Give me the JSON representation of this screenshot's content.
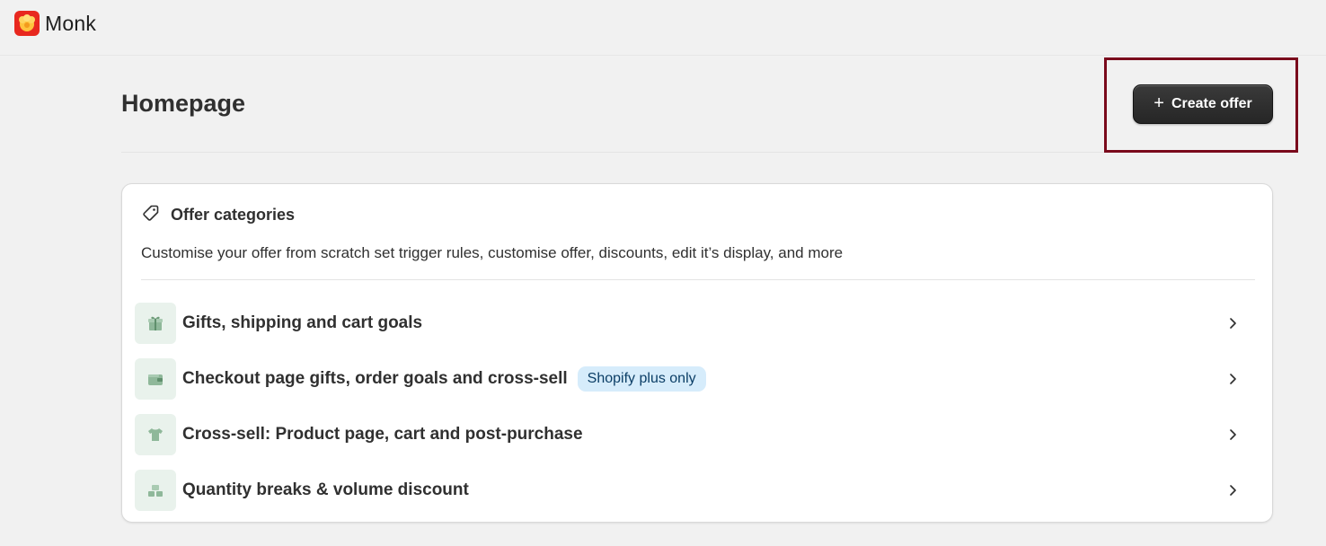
{
  "app": {
    "name": "Monk",
    "logo_icon": "monk-logo-icon",
    "brand_color": "#e8281f"
  },
  "page": {
    "title": "Homepage"
  },
  "actions": {
    "create_offer_label": "Create offer",
    "create_offer_icon": "plus-icon",
    "highlight_color": "#7a0a1c"
  },
  "offer_categories": {
    "icon": "tag-icon",
    "title": "Offer categories",
    "description": "Customise your offer from scratch set trigger rules, customise offer, discounts, edit it’s display, and more",
    "items": [
      {
        "label": "Gifts, shipping and cart goals",
        "icon": "gift-icon",
        "badge": ""
      },
      {
        "label": "Checkout page gifts, order goals and cross-sell",
        "icon": "wallet-icon",
        "badge": "Shopify plus only"
      },
      {
        "label": "Cross-sell: Product page, cart and post-purchase",
        "icon": "tshirt-icon",
        "badge": ""
      },
      {
        "label": "Quantity breaks & volume discount",
        "icon": "stack-icon",
        "badge": ""
      }
    ]
  }
}
